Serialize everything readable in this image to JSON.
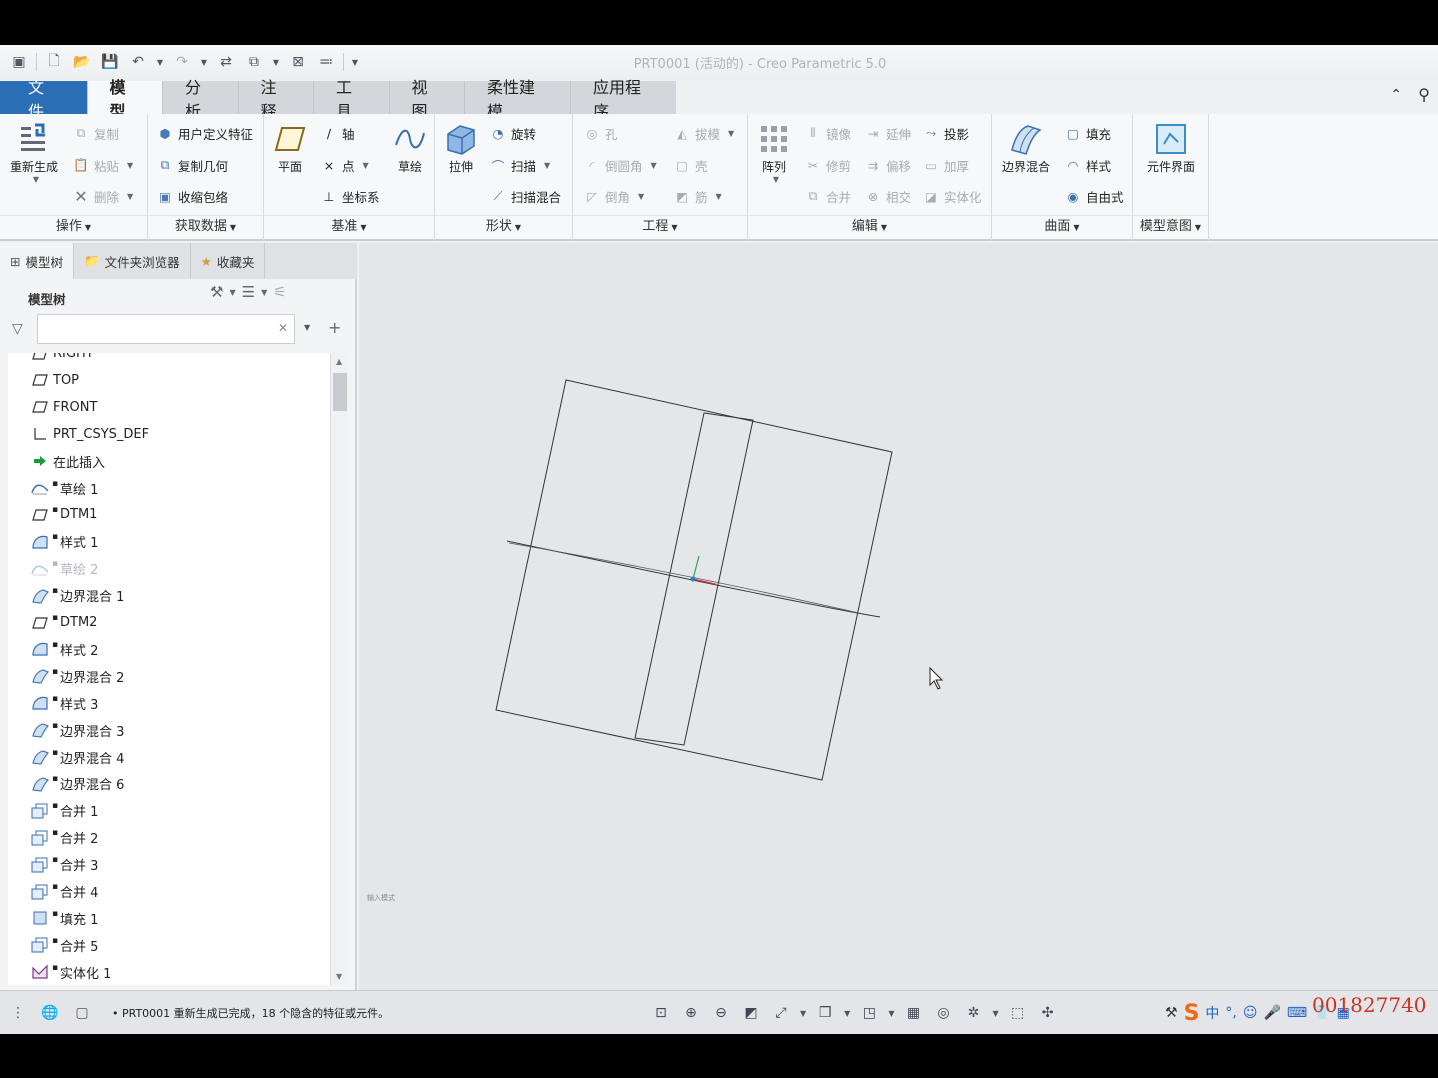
{
  "window": {
    "title": "PRT0001 (活动的) - Creo Parametric 5.0"
  },
  "tabs": [
    {
      "label": "文件"
    },
    {
      "label": "模型"
    },
    {
      "label": "分析"
    },
    {
      "label": "注释"
    },
    {
      "label": "工具"
    },
    {
      "label": "视图"
    },
    {
      "label": "柔性建模"
    },
    {
      "label": "应用程序"
    }
  ],
  "active_tab": "模型",
  "ribbon": {
    "operations": {
      "label": "操作",
      "regenerate": "重新生成",
      "copy": "复制",
      "paste": "粘贴",
      "delete": "删除"
    },
    "get_data": {
      "label": "获取数据",
      "udf": "用户定义特征",
      "copy_geom": "复制几何",
      "shrinkwrap": "收缩包络"
    },
    "datum": {
      "label": "基准",
      "plane": "平面",
      "axis": "轴",
      "point": "点",
      "csys": "坐标系",
      "sketch": "草绘"
    },
    "shapes": {
      "label": "形状",
      "extrude": "拉伸",
      "revolve": "旋转",
      "sweep": "扫描",
      "swept_blend": "扫描混合"
    },
    "engineering": {
      "label": "工程",
      "hole": "孔",
      "round": "倒圆角",
      "chamfer": "倒角",
      "draft": "拔模",
      "shell": "壳",
      "rib": "筋"
    },
    "editing": {
      "label": "编辑",
      "pattern": "阵列",
      "mirror": "镜像",
      "trim": "修剪",
      "merge": "合并",
      "extend": "延伸",
      "offset": "偏移",
      "intersect": "相交",
      "project": "投影",
      "thicken": "加厚",
      "solidify": "实体化"
    },
    "surfaces": {
      "label": "曲面",
      "boundary_blend": "边界混合",
      "fill": "填充",
      "style": "样式",
      "freestyle": "自由式"
    },
    "model_intent": {
      "label": "模型意图",
      "component_interface": "元件界面"
    }
  },
  "left_panel": {
    "tabs": [
      {
        "label": "模型树"
      },
      {
        "label": "文件夹浏览器"
      },
      {
        "label": "收藏夹"
      }
    ],
    "tree_title": "模型树",
    "filter_value": "",
    "items": [
      {
        "label": "RIGHT",
        "icon": "datum-plane-icon",
        "dim": false
      },
      {
        "label": "TOP",
        "icon": "datum-plane-icon",
        "dim": false
      },
      {
        "label": "FRONT",
        "icon": "datum-plane-icon",
        "dim": false
      },
      {
        "label": "PRT_CSYS_DEF",
        "icon": "csys-icon",
        "dim": false
      },
      {
        "label": "在此插入",
        "icon": "insert-arrow-icon",
        "dim": false
      },
      {
        "label": "草绘 1",
        "icon": "sketch-icon",
        "dim": false
      },
      {
        "label": "DTM1",
        "icon": "datum-plane-icon",
        "dim": false
      },
      {
        "label": "样式 1",
        "icon": "style-icon",
        "dim": false
      },
      {
        "label": "草绘 2",
        "icon": "sketch-icon",
        "dim": true
      },
      {
        "label": "边界混合 1",
        "icon": "boundary-blend-icon",
        "dim": false
      },
      {
        "label": "DTM2",
        "icon": "datum-plane-icon",
        "dim": false
      },
      {
        "label": "样式 2",
        "icon": "style-icon",
        "dim": false
      },
      {
        "label": "边界混合 2",
        "icon": "boundary-blend-icon",
        "dim": false
      },
      {
        "label": "样式 3",
        "icon": "style-icon",
        "dim": false
      },
      {
        "label": "边界混合 3",
        "icon": "boundary-blend-icon",
        "dim": false
      },
      {
        "label": "边界混合 4",
        "icon": "boundary-blend-icon",
        "dim": false
      },
      {
        "label": "边界混合 6",
        "icon": "boundary-blend-icon",
        "dim": false
      },
      {
        "label": "合并 1",
        "icon": "merge-icon",
        "dim": false
      },
      {
        "label": "合并 2",
        "icon": "merge-icon",
        "dim": false
      },
      {
        "label": "合并 3",
        "icon": "merge-icon",
        "dim": false
      },
      {
        "label": "合并 4",
        "icon": "merge-icon",
        "dim": false
      },
      {
        "label": "填充 1",
        "icon": "fill-icon",
        "dim": false
      },
      {
        "label": "合并 5",
        "icon": "merge-icon",
        "dim": false
      },
      {
        "label": "实体化 1",
        "icon": "solidify-icon",
        "dim": false
      }
    ]
  },
  "viewport": {
    "note": "输入模式"
  },
  "status": {
    "message": "• PRT0001 重新生成已完成，18 个隐含的特征或元件。"
  },
  "ime": {
    "label": "中"
  },
  "watermark": "001827740",
  "colors": {
    "file_tab": "#2a6fb5",
    "viewport_bg": "#e4e6e8",
    "accent_red": "#cc3322"
  }
}
